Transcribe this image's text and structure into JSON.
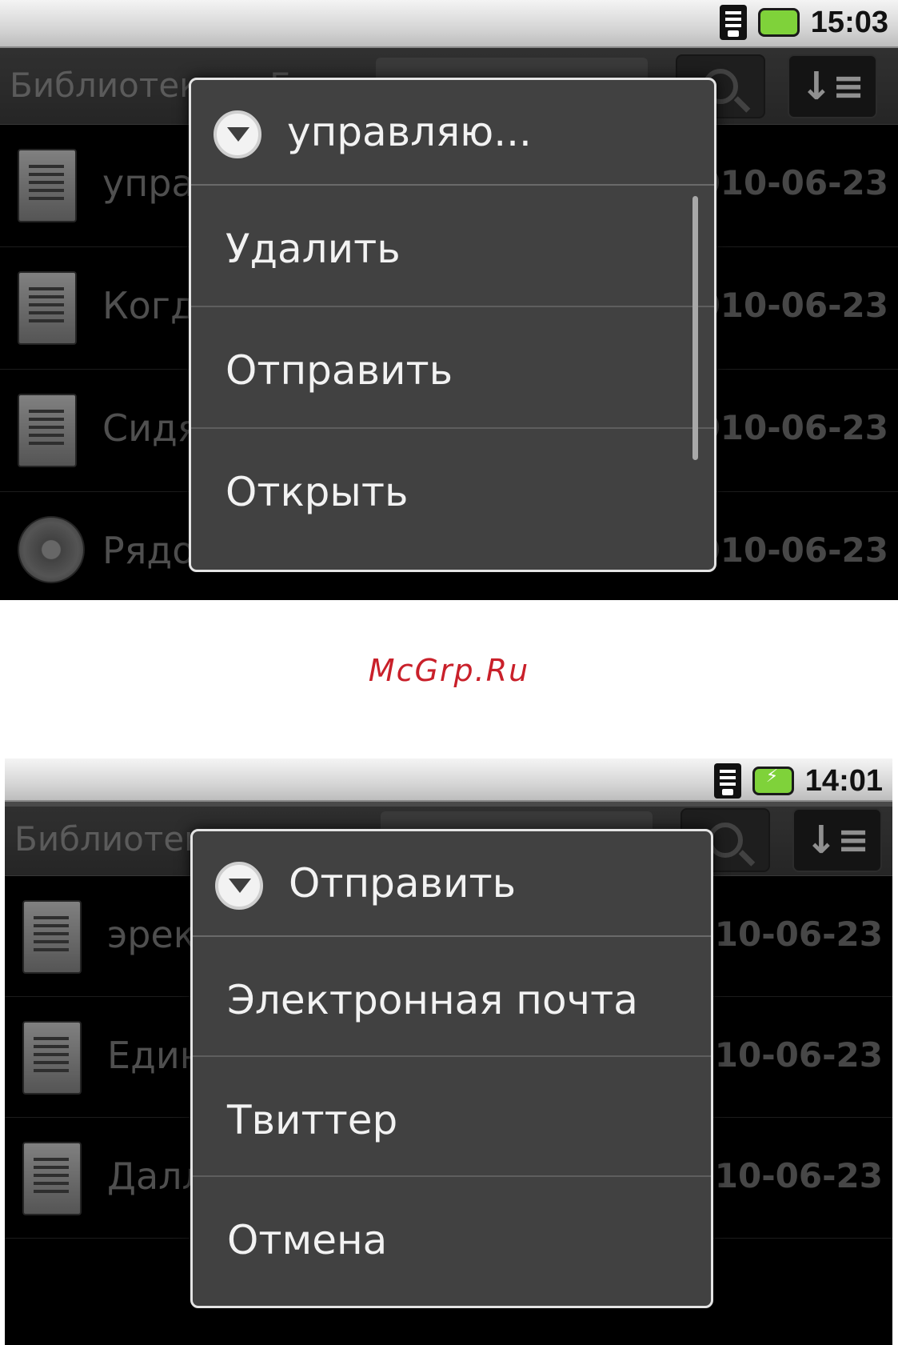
{
  "watermark": "McGrp.Ru",
  "screen1": {
    "status": {
      "time": "15:03"
    },
    "toolbar": {
      "title": "Библиотека > Гип..."
    },
    "rows": [
      {
        "title": "управляющи...",
        "date": "2010-06-23",
        "icon": "document-link-icon"
      },
      {
        "title": "Когда я с ...",
        "date": "2010-06-23",
        "icon": "document-reply-icon"
      },
      {
        "title": "Сидя в сто...",
        "date": "2010-06-23",
        "icon": "document-back-icon"
      },
      {
        "title": "Рядом со с...",
        "date": "2010-06-23",
        "icon": "music-disc-icon"
      }
    ],
    "dialog": {
      "title": "управляю...",
      "items": [
        "Удалить",
        "Отправить",
        "Открыть"
      ]
    }
  },
  "screen2": {
    "status": {
      "time": "14:01"
    },
    "toolbar": {
      "title": "Библиотека"
    },
    "rows": [
      {
        "title": "эрекция",
        "date": "2010-06-23",
        "icon": "document-icon"
      },
      {
        "title": "Единственн...",
        "date": "2010-06-23",
        "icon": "document-audio-icon"
      },
      {
        "title": "Далласе. Е...",
        "date": "2010-06-23",
        "icon": "document-icon"
      }
    ],
    "dialog": {
      "title": "Отправить",
      "items": [
        "Электронная почта",
        "Твиттер",
        "Отмена"
      ]
    }
  }
}
